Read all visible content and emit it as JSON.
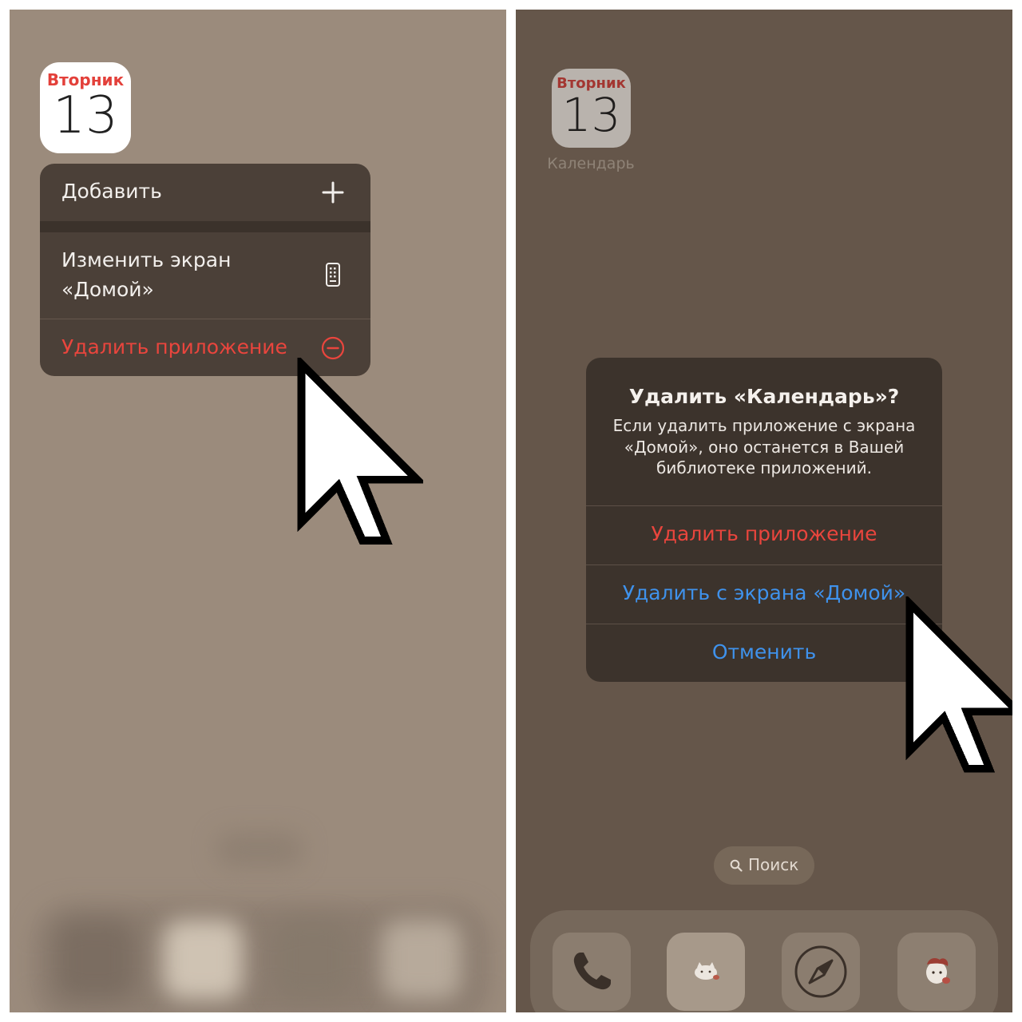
{
  "left_screen": {
    "calendar_icon": {
      "weekday": "Вторник",
      "day": "13"
    },
    "context_menu": {
      "items": [
        {
          "label": "Добавить",
          "icon": "plus-icon"
        },
        {
          "label_line1": "Изменить экран",
          "label_line2": "«Домой»",
          "icon": "phone-screen-icon"
        },
        {
          "label": "Удалить приложение",
          "icon": "minus-circle-icon",
          "destructive": true
        }
      ]
    }
  },
  "right_screen": {
    "calendar_icon": {
      "weekday": "Вторник",
      "day": "13",
      "app_name": "Календарь"
    },
    "alert": {
      "title": "Удалить «Календарь»?",
      "message_lines": [
        "Если удалить приложение с экрана",
        "«Домой», оно останется в Вашей",
        "библиотеке приложений."
      ],
      "buttons": [
        {
          "label": "Удалить приложение",
          "style": "destructive"
        },
        {
          "label": "Удалить с экрана «Домой»",
          "style": "default"
        },
        {
          "label": "Отменить",
          "style": "cancel"
        }
      ]
    },
    "search_pill": {
      "label": "Поиск",
      "icon": "search-icon"
    },
    "dock": {
      "apps": [
        "phone-icon",
        "cat-app-icon",
        "compass-icon",
        "sticker-app-icon"
      ]
    }
  },
  "colors": {
    "left_background": "#9b8b7c",
    "right_background": "#65564a",
    "destructive": "#e9453d",
    "action_blue": "#3f92ec"
  }
}
